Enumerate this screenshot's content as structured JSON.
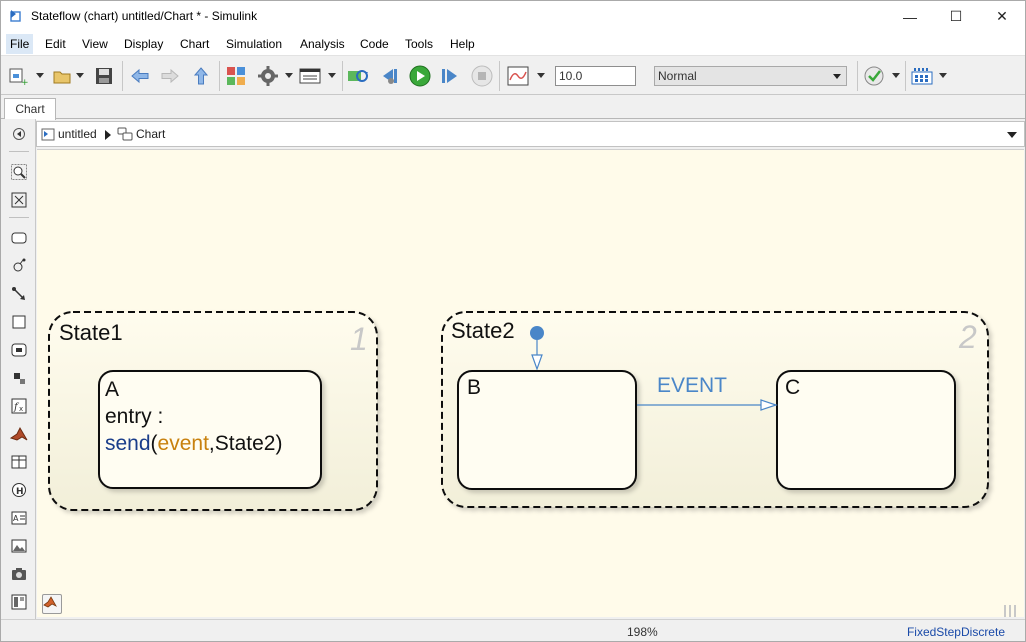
{
  "window": {
    "title": "Stateflow (chart) untitled/Chart * - Simulink",
    "minimize_glyph": "—",
    "maximize_glyph": "☐",
    "close_glyph": "✕"
  },
  "menu": {
    "items": [
      "File",
      "Edit",
      "View",
      "Display",
      "Chart",
      "Simulation",
      "Analysis",
      "Code",
      "Tools",
      "Help"
    ]
  },
  "toolbar": {
    "stop_time": "10.0",
    "sim_mode": "Normal"
  },
  "tabs": {
    "active": "Chart"
  },
  "breadcrumb": {
    "model": "untitled",
    "chart": "Chart"
  },
  "chart": {
    "state1": {
      "name": "State1",
      "order": "1",
      "substate": {
        "name": "A",
        "entry_label": "entry :",
        "send_fn": "send",
        "open_paren": "(",
        "arg_event": "event",
        "arg_rest": ",State2)"
      }
    },
    "state2": {
      "name": "State2",
      "order": "2",
      "substate_b": "B",
      "substate_c": "C",
      "transition_label": "EVENT"
    }
  },
  "colors": {
    "keyword_blue": "#1a3d8a",
    "event_orange": "#c8810e",
    "transition_blue": "#4a86c8",
    "canvas_bg": "#fffbea",
    "order_gray": "#c8c8c8"
  },
  "status": {
    "zoom": "198%",
    "solver": "FixedStepDiscrete"
  }
}
